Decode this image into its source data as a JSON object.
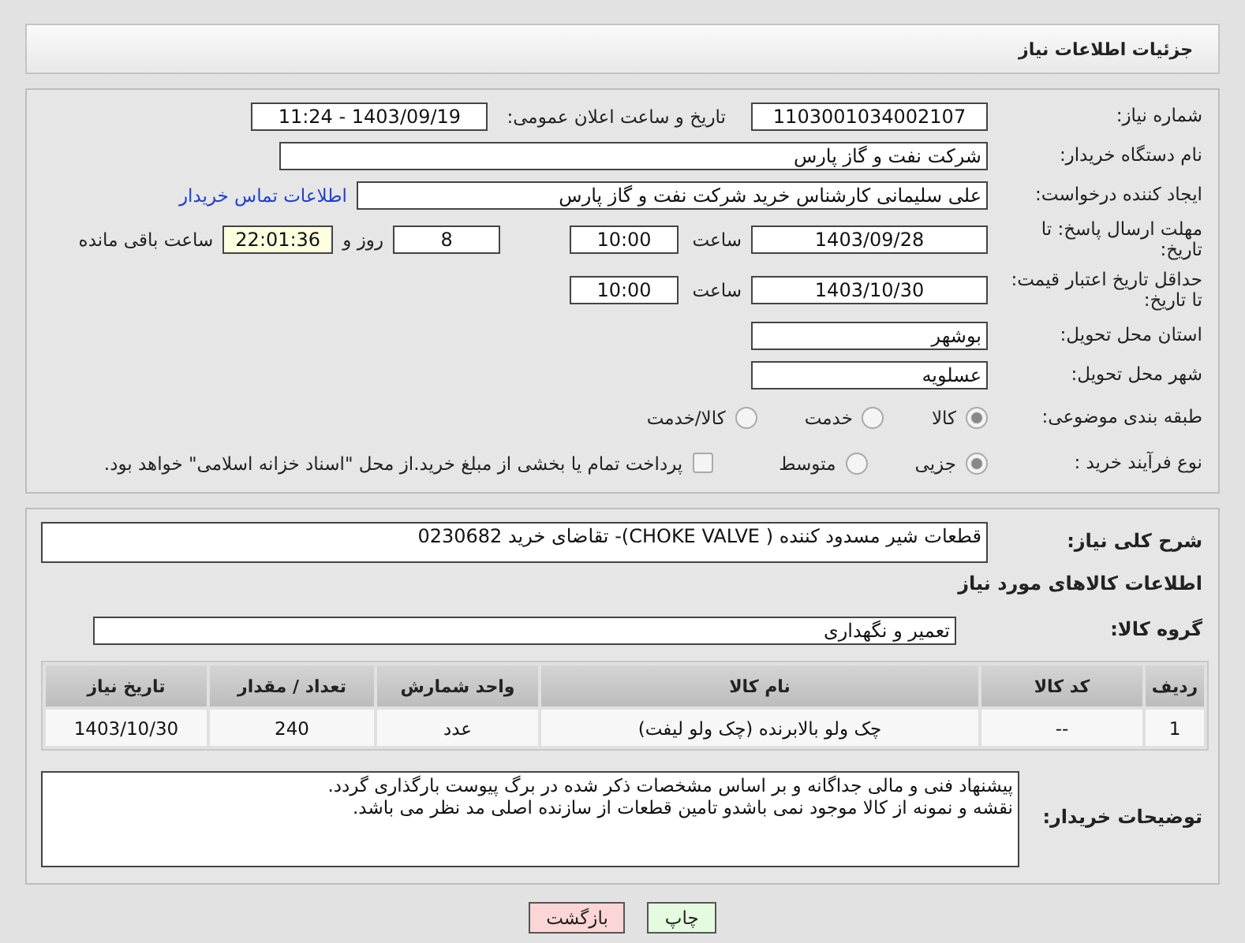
{
  "header": {
    "title": "جزئیات اطلاعات نیاز"
  },
  "need": {
    "number_label": "شماره نیاز:",
    "number": "1103001034002107",
    "announce_label": "تاریخ و ساعت اعلان عمومی:",
    "announce": "1403/09/19 - 11:24"
  },
  "buyer": {
    "label": "نام دستگاه خریدار:",
    "value": "شرکت نفت و گاز پارس"
  },
  "requester": {
    "label": "ایجاد کننده درخواست:",
    "value": "علی سلیمانی کارشناس خرید شرکت نفت و گاز پارس",
    "link": "اطلاعات تماس خریدار"
  },
  "deadline": {
    "label": "مهلت ارسال پاسخ: تا تاریخ:",
    "date": "1403/09/28",
    "time_label": "ساعت",
    "time": "10:00",
    "days": "8",
    "days_label": "روز و",
    "remaining": "22:01:36",
    "remaining_label": "ساعت باقی مانده"
  },
  "validity": {
    "label": "حداقل تاریخ اعتبار قیمت: تا تاریخ:",
    "date": "1403/10/30",
    "time_label": "ساعت",
    "time": "10:00"
  },
  "province": {
    "label": "استان محل تحویل:",
    "value": "بوشهر"
  },
  "city": {
    "label": "شهر محل تحویل:",
    "value": "عسلویه"
  },
  "category": {
    "label": "طبقه بندی موضوعی:",
    "options": [
      {
        "label": "کالا",
        "selected": true
      },
      {
        "label": "خدمت",
        "selected": false
      },
      {
        "label": "کالا/خدمت",
        "selected": false
      }
    ]
  },
  "process": {
    "label": "نوع فرآیند خرید :",
    "options": [
      {
        "label": "جزیی",
        "selected": true
      },
      {
        "label": "متوسط",
        "selected": false
      }
    ],
    "treasury": {
      "label": "پرداخت تمام یا بخشی از مبلغ خرید.از محل \"اسناد خزانه اسلامی\" خواهد بود.",
      "checked": false
    }
  },
  "description": {
    "label": "شرح کلی نیاز:",
    "value": "قطعات شیر مسدود کننده ( CHOKE VALVE)- تقاضای خرید 0230682"
  },
  "goods_title": "اطلاعات کالاهای مورد نیاز",
  "goods_group": {
    "label": "گروه کالا:",
    "value": "تعمیر و نگهداری"
  },
  "table": {
    "columns": [
      "ردیف",
      "کد کالا",
      "نام کالا",
      "واحد شمارش",
      "تعداد / مقدار",
      "تاریخ نیاز"
    ],
    "rows": [
      [
        "1",
        "--",
        "چک ولو بالابرنده (چک ولو لیفت)",
        "عدد",
        "240",
        "1403/10/30"
      ]
    ]
  },
  "buyer_notes": {
    "label": "توضیحات خریدار:",
    "lines": [
      "پیشنهاد فنی و مالی جداگانه و بر اساس مشخصات ذکر شده در برگ پیوست بارگذاری گردد.",
      "نقشه و نمونه از کالا موجود نمی باشدو تامین قطعات از سازنده اصلی مد نظر می باشد."
    ]
  },
  "buttons": [
    {
      "label": "چاپ",
      "kind": "print"
    },
    {
      "label": "بازگشت",
      "kind": "back"
    }
  ]
}
